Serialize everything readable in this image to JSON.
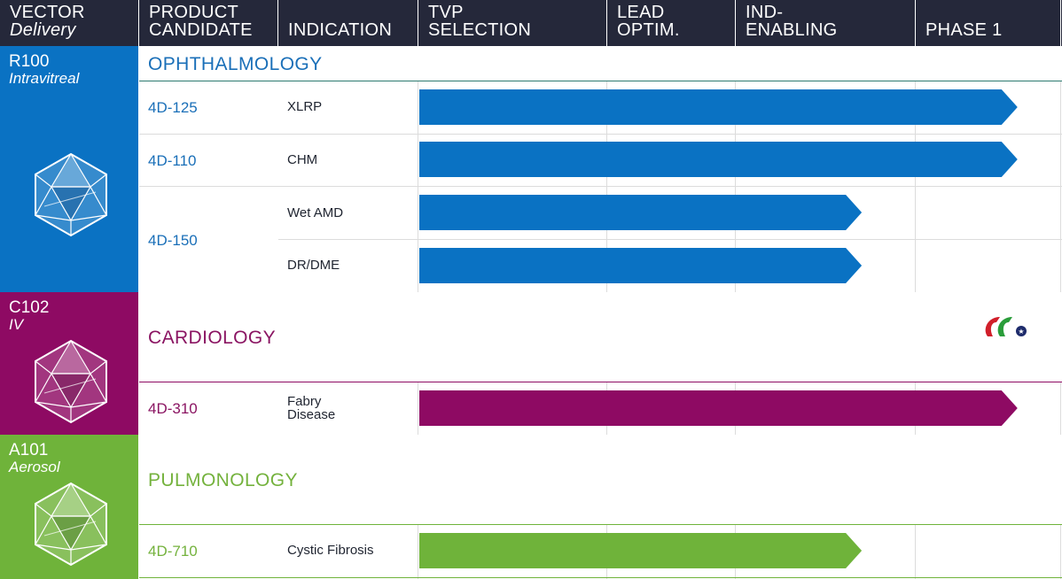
{
  "header": {
    "vector": "VECTOR",
    "vector_sub": "Delivery",
    "candidate_1": "PRODUCT",
    "candidate_2": "CANDIDATE",
    "indication": "INDICATION",
    "stages": [
      {
        "l1": "TVP",
        "l2": "SELECTION"
      },
      {
        "l1": "LEAD",
        "l2": "OPTIM."
      },
      {
        "l1": "IND-",
        "l2": "ENABLING"
      },
      {
        "l1": "",
        "l2": "PHASE 1"
      }
    ]
  },
  "colors": {
    "header_bg": "#25283a",
    "ophthalmology": "#0a72c3",
    "cardiology": "#8e0a63",
    "pulmonology": "#6fb33a",
    "ophthalmology_text": "#1a6fb8",
    "pulmonology_text": "#74b23d",
    "cardiology_text": "#8a1462"
  },
  "vectors": [
    {
      "name": "R100",
      "route": "Intravitreal",
      "icon": "icosahedron-icon"
    },
    {
      "name": "C102",
      "route": "IV",
      "icon": "icosahedron-icon"
    },
    {
      "name": "A101",
      "route": "Aerosol",
      "icon": "icosahedron-icon"
    }
  ],
  "areas": {
    "ophthalmology": "OPHTHALMOLOGY",
    "cardiology": "CARDIOLOGY",
    "pulmonology": "PULMONOLOGY"
  },
  "logo": "company-logo-icon",
  "chart_data": {
    "type": "bar",
    "orientation": "horizontal",
    "stages": [
      "TVP SELECTION",
      "LEAD OPTIM.",
      "IND-ENABLING",
      "PHASE 1"
    ],
    "value_unit": "stages of progress (0-4)",
    "rows": [
      {
        "candidate": "4D-125",
        "indication": "XLRP",
        "area": "ophthalmology",
        "progress": 3.7
      },
      {
        "candidate": "4D-110",
        "indication": "CHM",
        "area": "ophthalmology",
        "progress": 3.7
      },
      {
        "candidate": "4D-150",
        "indication": "Wet AMD",
        "area": "ophthalmology",
        "progress": 2.7
      },
      {
        "candidate": "",
        "indication": "DR/DME",
        "area": "ophthalmology",
        "progress": 2.7
      },
      {
        "candidate": "4D-310",
        "indication": "Fabry Disease",
        "area": "cardiology",
        "progress": 3.7
      },
      {
        "candidate": "4D-710",
        "indication": "Cystic Fibrosis",
        "area": "pulmonology",
        "progress": 2.7
      }
    ]
  }
}
